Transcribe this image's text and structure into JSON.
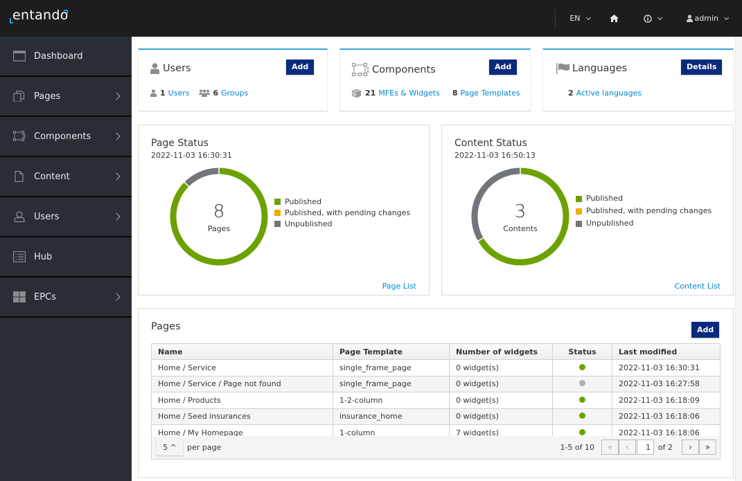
{
  "topbar": {
    "logo_text": "entando",
    "language": "EN",
    "user": "admin"
  },
  "sidebar": {
    "items": [
      {
        "label": "Dashboard",
        "icon": "dashboard-icon",
        "has_children": false
      },
      {
        "label": "Pages",
        "icon": "pages-icon",
        "has_children": true
      },
      {
        "label": "Components",
        "icon": "components-icon",
        "has_children": true
      },
      {
        "label": "Content",
        "icon": "content-icon",
        "has_children": true
      },
      {
        "label": "Users",
        "icon": "user-icon",
        "has_children": true
      },
      {
        "label": "Hub",
        "icon": "hub-icon",
        "has_children": false
      },
      {
        "label": "EPCs",
        "icon": "epcs-icon",
        "has_children": true
      }
    ]
  },
  "cards": {
    "users": {
      "title": "Users",
      "button": "Add",
      "users_count": "1",
      "users_label": "Users",
      "groups_count": "6",
      "groups_label": "Groups"
    },
    "components": {
      "title": "Components",
      "button": "Add",
      "mfes_count": "21",
      "mfes_label": "MFEs & Widgets",
      "templates_count": "8",
      "templates_label": "Page Templates"
    },
    "languages": {
      "title": "Languages",
      "button": "Details",
      "active_count": "2",
      "active_label": "Active languages"
    }
  },
  "page_status": {
    "title": "Page Status",
    "date": "2022-11-03 16:30:31",
    "total": "8",
    "total_label": "Pages",
    "link": "Page List"
  },
  "content_status": {
    "title": "Content Status",
    "date": "2022-11-03 16:50:13",
    "total": "3",
    "total_label": "Contents",
    "link": "Content List"
  },
  "legend": {
    "published": "Published",
    "pending": "Published, with pending changes",
    "unpublished": "Unpublished"
  },
  "colors": {
    "published": "#6ca100",
    "pending": "#f0ab00",
    "unpublished": "#72767b",
    "status_gray": "#b0b0b0",
    "primary": "#0b2a7d",
    "link": "#0088ce"
  },
  "chart_data": [
    {
      "type": "pie",
      "title": "Page Status",
      "categories": [
        "Published",
        "Published, with pending changes",
        "Unpublished"
      ],
      "values": [
        7,
        0,
        1
      ],
      "center_value": 8,
      "center_label": "Pages"
    },
    {
      "type": "pie",
      "title": "Content Status",
      "categories": [
        "Published",
        "Published, with pending changes",
        "Unpublished"
      ],
      "values": [
        2,
        0,
        1
      ],
      "center_value": 3,
      "center_label": "Contents"
    }
  ],
  "pages_table": {
    "title": "Pages",
    "add_button": "Add",
    "columns": [
      "Name",
      "Page Template",
      "Number of widgets",
      "Status",
      "Last modified"
    ],
    "rows": [
      {
        "name": "Home / Service",
        "template": "single_frame_page",
        "widgets": "0 widget(s)",
        "status": "published",
        "modified": "2022-11-03 16:30:31"
      },
      {
        "name": "Home / Service / Page not found",
        "template": "single_frame_page",
        "widgets": "0 widget(s)",
        "status": "unpublished",
        "modified": "2022-11-03 16:27:58"
      },
      {
        "name": "Home / Products",
        "template": "1-2-column",
        "widgets": "0 widget(s)",
        "status": "published",
        "modified": "2022-11-03 16:18:09"
      },
      {
        "name": "Home / Seed insurances",
        "template": "insurance_home",
        "widgets": "0 widget(s)",
        "status": "published",
        "modified": "2022-11-03 16:18:06"
      },
      {
        "name": "Home / My Homepage",
        "template": "1-column",
        "widgets": "7 widget(s)",
        "status": "published",
        "modified": "2022-11-03 16:18:06"
      }
    ],
    "pagination": {
      "per_page": "5 ^",
      "per_page_label": "per page",
      "range": "1-5 of 10",
      "current_page": "1",
      "of_pages": "of 2",
      "first": "«",
      "prev": "‹",
      "next": "›",
      "last": "»"
    }
  }
}
